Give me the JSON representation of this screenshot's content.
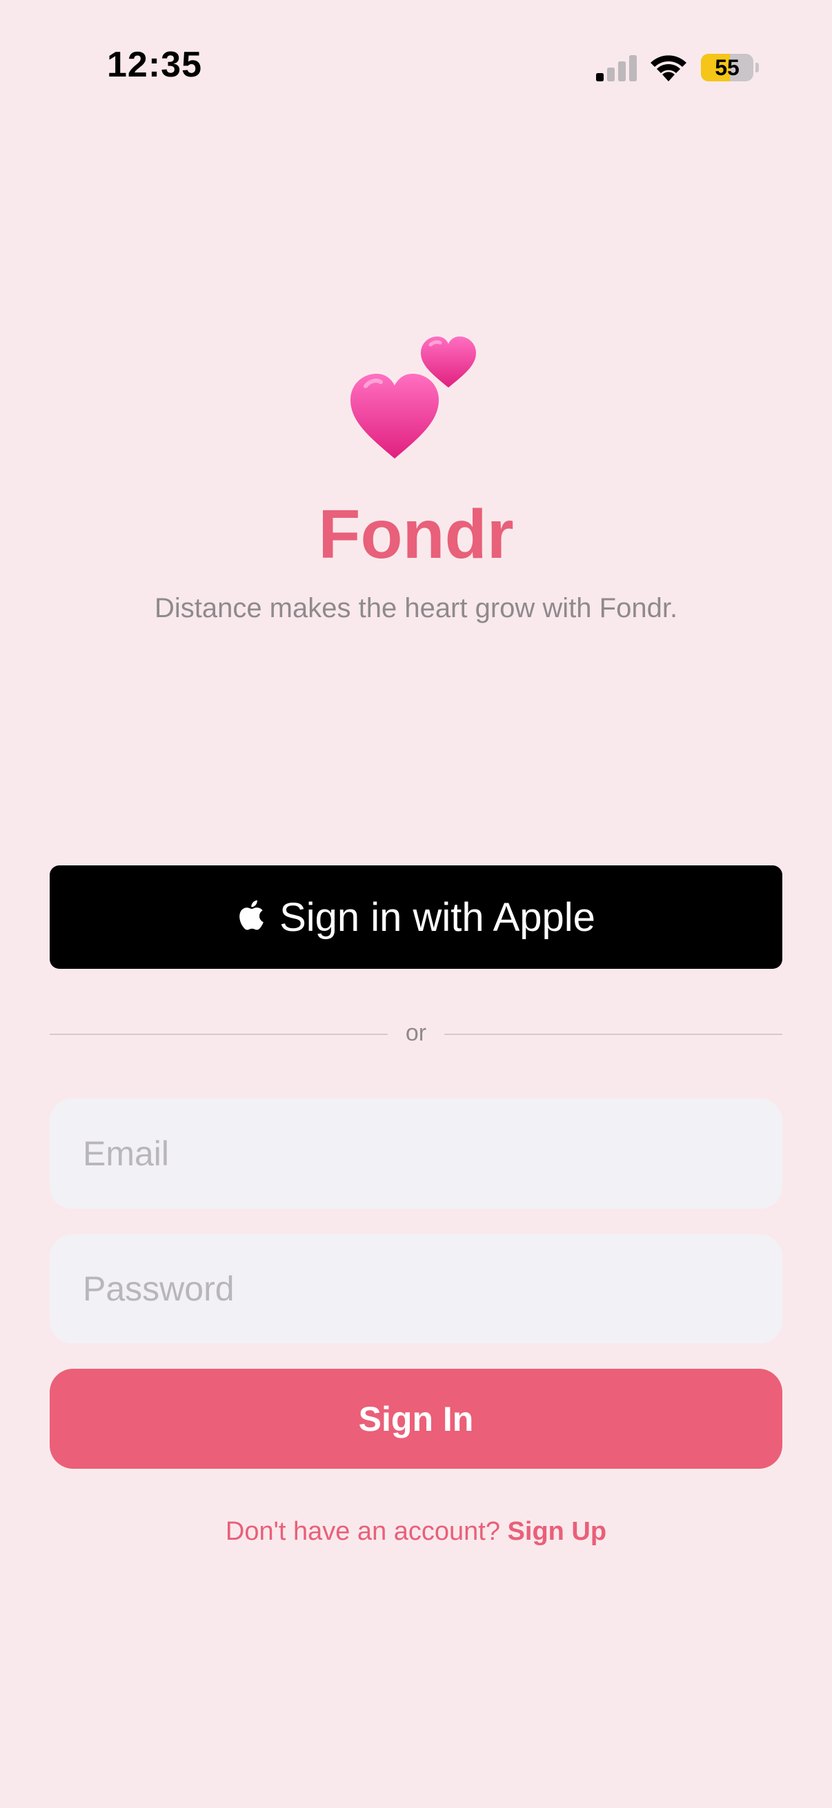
{
  "status_bar": {
    "time": "12:35",
    "battery_level": 55,
    "battery_label": "55",
    "signal_icon": "cellular-signal-icon",
    "wifi_icon": "wifi-icon",
    "battery_color": "#F5C518"
  },
  "hero": {
    "logo_icon": "two-hearts-icon",
    "app_name": "Fondr",
    "tagline": "Distance makes the heart grow with Fondr."
  },
  "apple_sign_in": {
    "icon": "apple-logo-icon",
    "label": "Sign in with Apple"
  },
  "divider": {
    "label": "or"
  },
  "form": {
    "email": {
      "value": "",
      "placeholder": "Email"
    },
    "password": {
      "value": "",
      "placeholder": "Password"
    },
    "submit_label": "Sign In"
  },
  "footer": {
    "prompt": "Don't have an account?",
    "signup_label": "Sign Up"
  },
  "colors": {
    "background": "#FAE9EC",
    "accent": "#E8607A",
    "button": "#EB5F78",
    "field": "#F2F1F6",
    "heart": "#F2409A"
  }
}
